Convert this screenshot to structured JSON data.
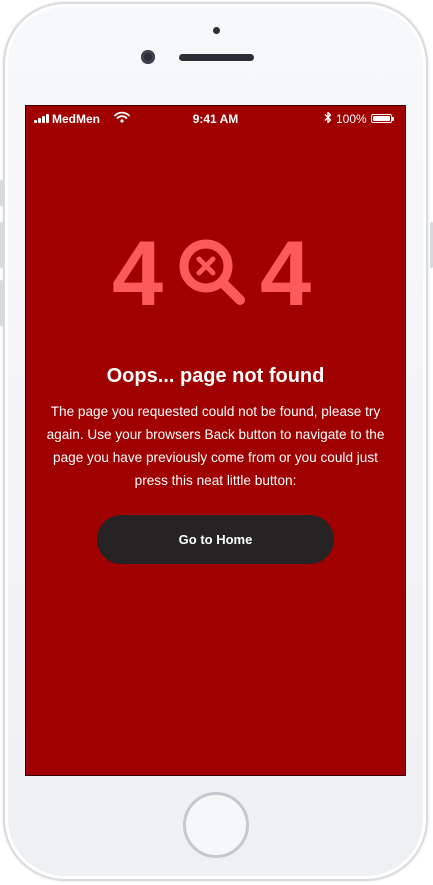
{
  "status_bar": {
    "carrier": "MedMen",
    "time": "9:41 AM",
    "battery_percent": "100%"
  },
  "error_page": {
    "code_left_digit": "4",
    "code_right_digit": "4",
    "title": "Oops... page not found",
    "message": "The page you requested could not be found, please try again. Use your browsers Back button to navigate to the page you have previously come from or you could just press this neat little button:",
    "home_button_label": "Go to Home"
  },
  "colors": {
    "background": "#a00000",
    "accent_404": "#ff5a5a",
    "button_bg": "#252323",
    "text": "#ffffff"
  },
  "icons": [
    "signal-bars-icon",
    "wifi-icon",
    "bluetooth-icon",
    "battery-icon",
    "magnifier-x-icon"
  ]
}
